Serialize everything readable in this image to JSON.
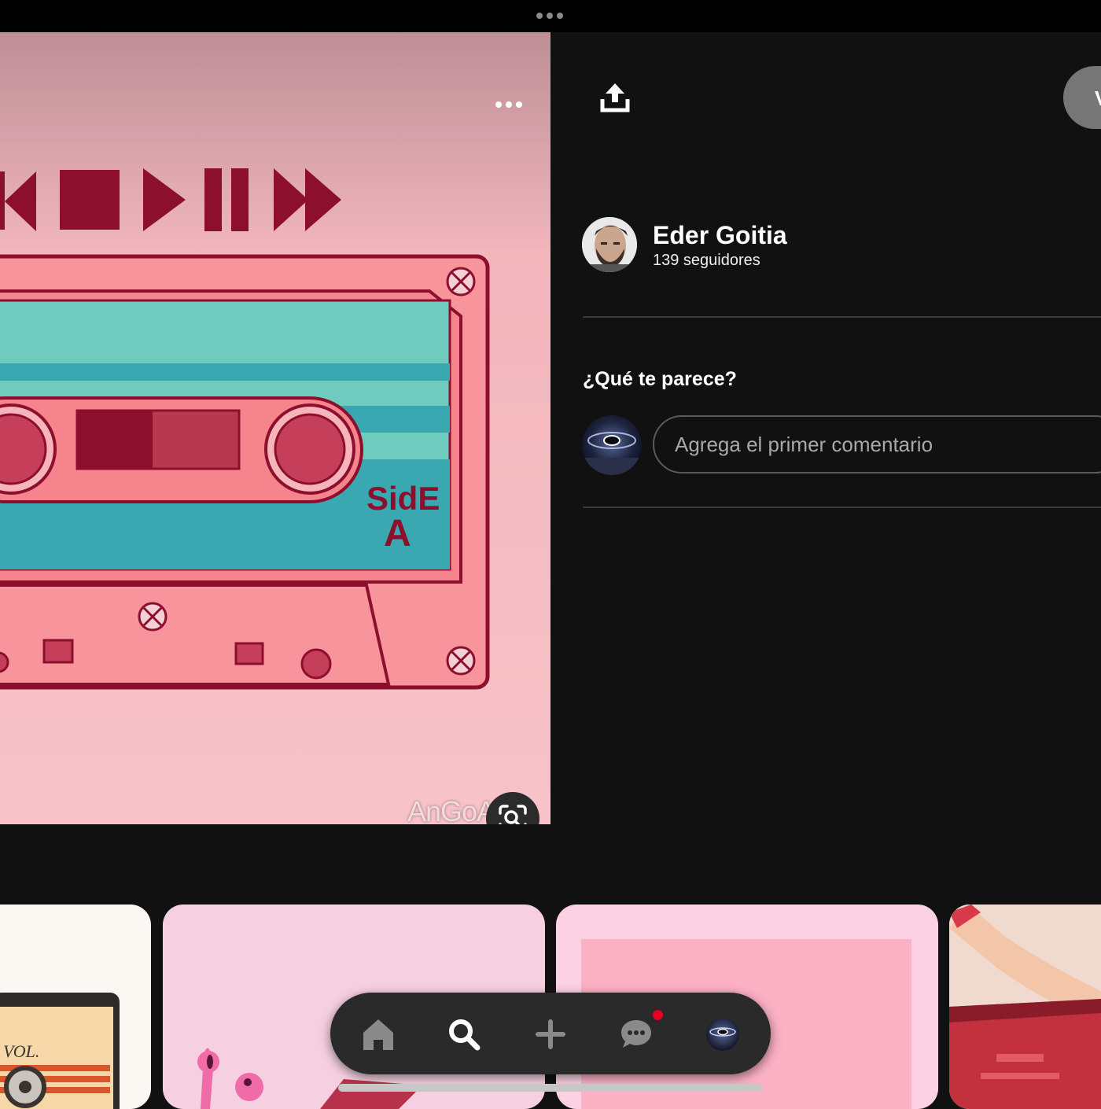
{
  "app": {
    "status_bar": {
      "icon": "multitasking-dots-icon"
    },
    "pin": {
      "more_icon": "more-options-icon",
      "watermark_text": "AnGoA",
      "lens_icon": "visual-search-icon",
      "image_side_label_line1": "SidE",
      "image_side_label_line2": "A"
    },
    "header": {
      "share_icon": "share-icon",
      "save_label": "V"
    },
    "author": {
      "name": "Eder Goitia",
      "followers": "139 seguidores"
    },
    "comments": {
      "heading": "¿Qué te parece?",
      "placeholder": "Agrega el primer comentario"
    },
    "related": {
      "card1_text": "VOL."
    },
    "nav": {
      "items": [
        "home-icon",
        "search-icon",
        "create-icon",
        "messages-icon",
        "profile-avatar"
      ],
      "messages_has_notification": true
    },
    "colors": {
      "background": "#111111",
      "notification": "#e60023",
      "save_button": "#767676"
    }
  }
}
